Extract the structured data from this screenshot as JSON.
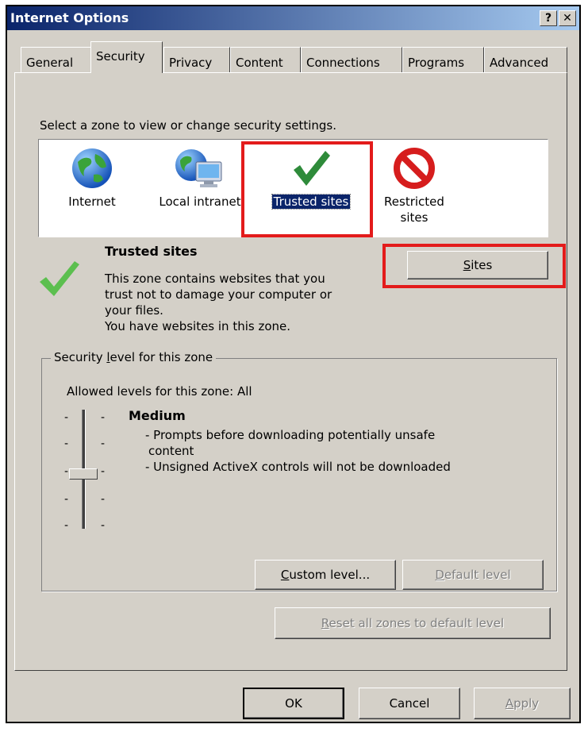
{
  "window": {
    "title": "Internet Options",
    "help_button": "?",
    "close_button": "✕"
  },
  "tabs": [
    {
      "label": "General"
    },
    {
      "label": "Security"
    },
    {
      "label": "Privacy"
    },
    {
      "label": "Content"
    },
    {
      "label": "Connections"
    },
    {
      "label": "Programs"
    },
    {
      "label": "Advanced"
    }
  ],
  "active_tab": "Security",
  "zone_prompt": "Select a zone to view or change security settings.",
  "zones": [
    {
      "label": "Internet",
      "icon": "globe-icon"
    },
    {
      "label": "Local intranet",
      "icon": "intranet-globe-monitor-icon"
    },
    {
      "label": "Trusted sites",
      "icon": "green-checkmark-icon",
      "selected": true
    },
    {
      "label_line1": "Restricted",
      "label_line2": "sites",
      "icon": "red-prohibited-icon"
    }
  ],
  "zone_info": {
    "title": "Trusted sites",
    "line1": "This zone contains websites that you",
    "line2": "trust not to damage your computer or",
    "line3": "your files.",
    "line4": "You have websites in this zone."
  },
  "sites_button": {
    "label": "Sites",
    "mnemonic_label": "S",
    "rest": "ites"
  },
  "security_level": {
    "group_label_prefix": "Security ",
    "group_label_mnemonic": "l",
    "group_label_suffix": "evel for this zone",
    "allowed": "Allowed levels for this zone: All",
    "level_name": "Medium",
    "bullet1_line1": "- Prompts before downloading potentially unsafe",
    "bullet1_line2": "content",
    "bullet2": "- Unsigned ActiveX controls will not be downloaded",
    "slider_level": "Medium",
    "slider_position_of_5": 3
  },
  "buttons": {
    "custom_level_mnemonic": "C",
    "custom_level_rest": "ustom level...",
    "default_level_mnemonic": "D",
    "default_level_rest": "efault level",
    "reset_mnemonic": "R",
    "reset_rest": "eset all zones to default level",
    "ok": "OK",
    "cancel": "Cancel",
    "apply_mnemonic": "A",
    "apply_rest": "pply"
  },
  "colors": {
    "dialog_bg": "#d4d0c8",
    "title_gradient_start": "#0a246a",
    "title_gradient_end": "#a6caf0",
    "selection_bg": "#0a246a",
    "highlight_red": "#e31b1b",
    "checkmark_green": "#2e8b3a"
  }
}
